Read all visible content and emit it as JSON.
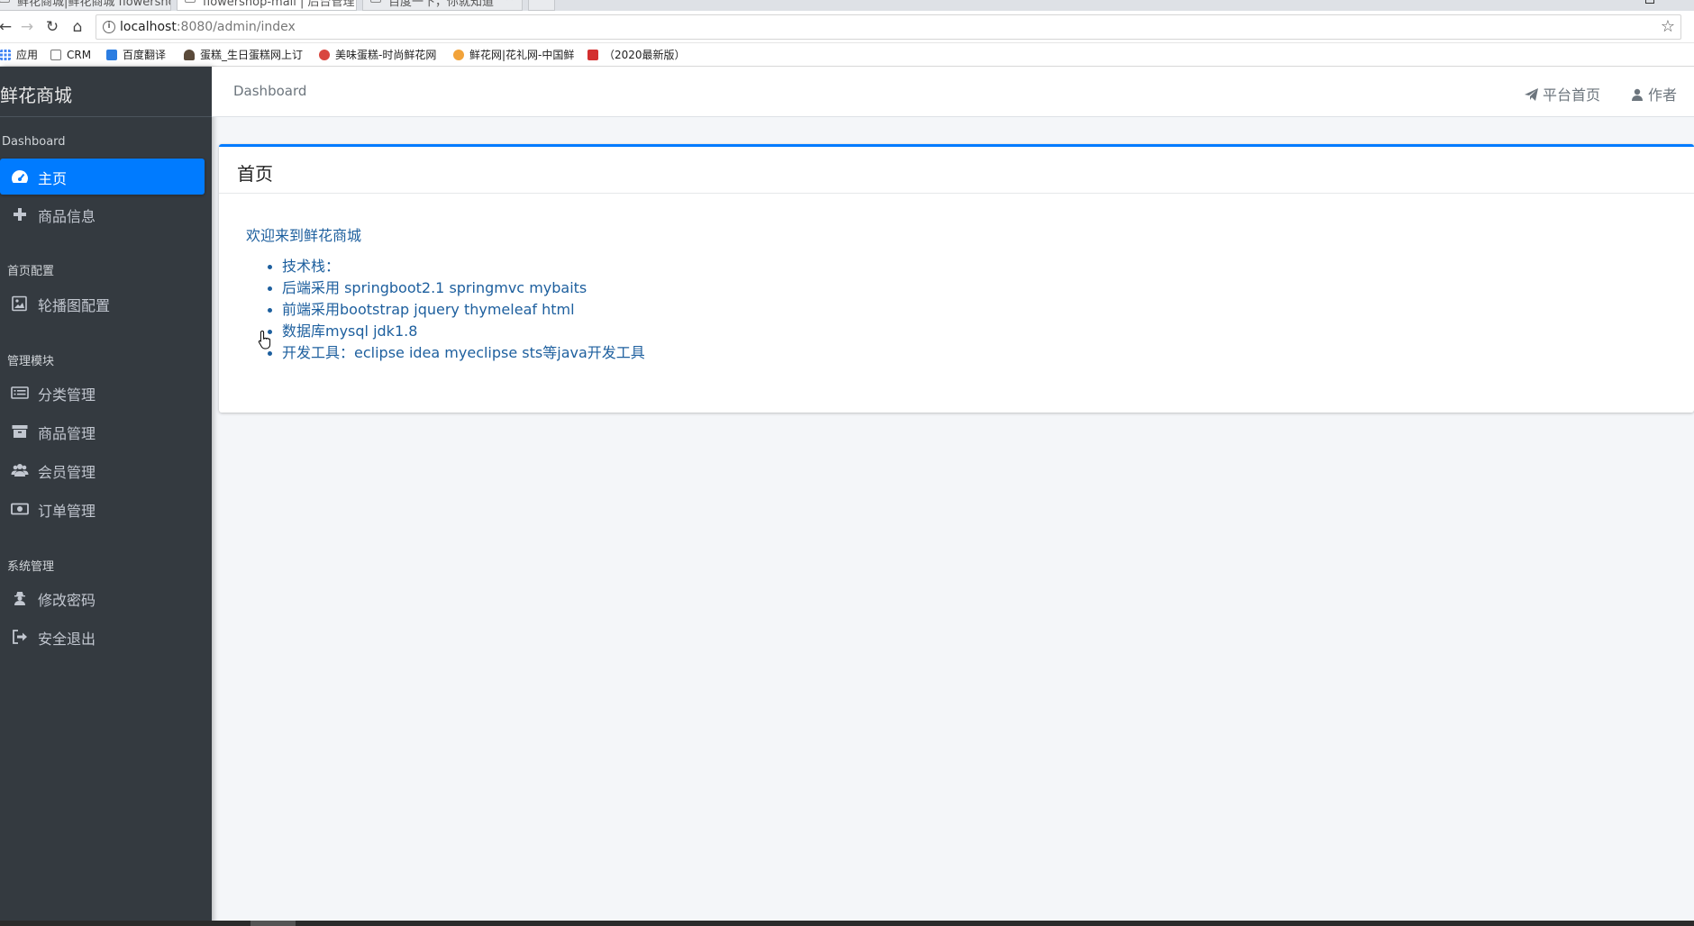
{
  "browser": {
    "tabs": [
      {
        "title": "鲜花商城|鲜花商城 flowershop-mall"
      },
      {
        "title": "flowershop-mall | 后台管理"
      },
      {
        "title": "百度一下，你就知道"
      }
    ],
    "url_host": "localhost",
    "url_path": ":8080/admin/index",
    "bookmarks": [
      {
        "label": "应用",
        "color": "#4285f4"
      },
      {
        "label": "CRM",
        "color": "#9e9e9e"
      },
      {
        "label": "百度翻译",
        "color": "#2b7de1"
      },
      {
        "label": "蛋糕_生日蛋糕网上订",
        "color": "#5a4a3a"
      },
      {
        "label": "美味蛋糕-时尚鲜花网",
        "color": "#d9473f"
      },
      {
        "label": "鲜花网|花礼网-中国鲜",
        "color": "#f2a33a"
      },
      {
        "label": "（2020最新版）",
        "color": "#d32f2f"
      }
    ]
  },
  "sidebar": {
    "brand": "鲜花商城",
    "sections": [
      {
        "header": "Dashboard",
        "items": [
          {
            "label": "主页",
            "icon": "tachometer-icon",
            "active": true
          },
          {
            "label": "商品信息",
            "icon": "plus-icon",
            "active": false
          }
        ]
      },
      {
        "header": "首页配置",
        "items": [
          {
            "label": "轮播图配置",
            "icon": "image-icon",
            "active": false
          }
        ]
      },
      {
        "header": "管理模块",
        "items": [
          {
            "label": "分类管理",
            "icon": "list-icon",
            "active": false
          },
          {
            "label": "商品管理",
            "icon": "archive-icon",
            "active": false
          },
          {
            "label": "会员管理",
            "icon": "users-icon",
            "active": false
          },
          {
            "label": "订单管理",
            "icon": "money-icon",
            "active": false
          }
        ]
      },
      {
        "header": "系统管理",
        "items": [
          {
            "label": "修改密码",
            "icon": "user-secret-icon",
            "active": false
          },
          {
            "label": "安全退出",
            "icon": "sign-out-icon",
            "active": false
          }
        ]
      }
    ]
  },
  "topnav": {
    "breadcrumb": "Dashboard",
    "platform_home": "平台首页",
    "author": "作者"
  },
  "card": {
    "title": "首页",
    "welcome": "欢迎来到鲜花商城",
    "features": [
      "技术栈：",
      "后端采用 springboot2.1 springmvc mybaits",
      "前端采用bootstrap jquery thymeleaf html",
      "数据库mysql jdk1.8",
      "开发工具：eclipse idea myeclipse sts等java开发工具"
    ]
  },
  "colors": {
    "sidebar_bg": "#343a40",
    "accent": "#007bff",
    "link": "#1d5f9e",
    "content_bg": "#f4f6f9"
  }
}
